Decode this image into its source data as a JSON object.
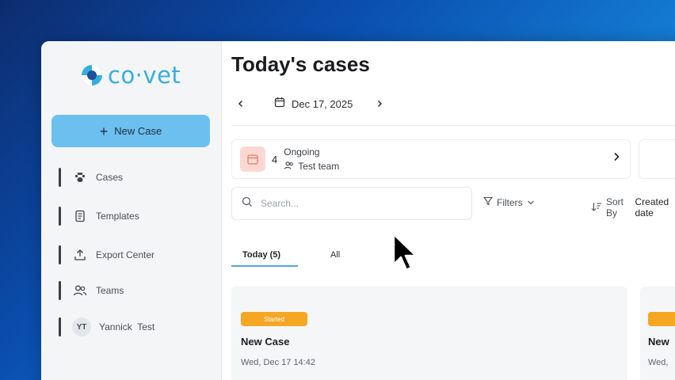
{
  "app": {
    "logo_text": "co·vet",
    "brand_color": "#36aee0"
  },
  "sidebar": {
    "new_case_label": "New Case",
    "items": [
      {
        "label": "Cases",
        "icon": "paw-icon"
      },
      {
        "label": "Templates",
        "icon": "document-icon"
      },
      {
        "label": "Export Center",
        "icon": "upload-icon"
      },
      {
        "label": "Teams",
        "icon": "users-icon"
      }
    ],
    "user": {
      "initials": "YT",
      "name": "Yannick  Test"
    }
  },
  "main": {
    "title": "Today's cases",
    "date": "Dec 17, 2025",
    "summary": {
      "count": "4",
      "title": "Ongoing",
      "team": "Test team"
    },
    "search_placeholder": "Search...",
    "filters_label": "Filters",
    "sort_label": "Sort By",
    "sort_value": "Created date",
    "tabs": [
      {
        "label": "Today (5)",
        "active": true
      },
      {
        "label": "All",
        "active": false
      }
    ],
    "cards": [
      {
        "status": "Started",
        "title": "New Case",
        "date": "Wed, Dec 17 14:42"
      },
      {
        "status": "",
        "title": "New",
        "date": "Wed,"
      }
    ]
  }
}
